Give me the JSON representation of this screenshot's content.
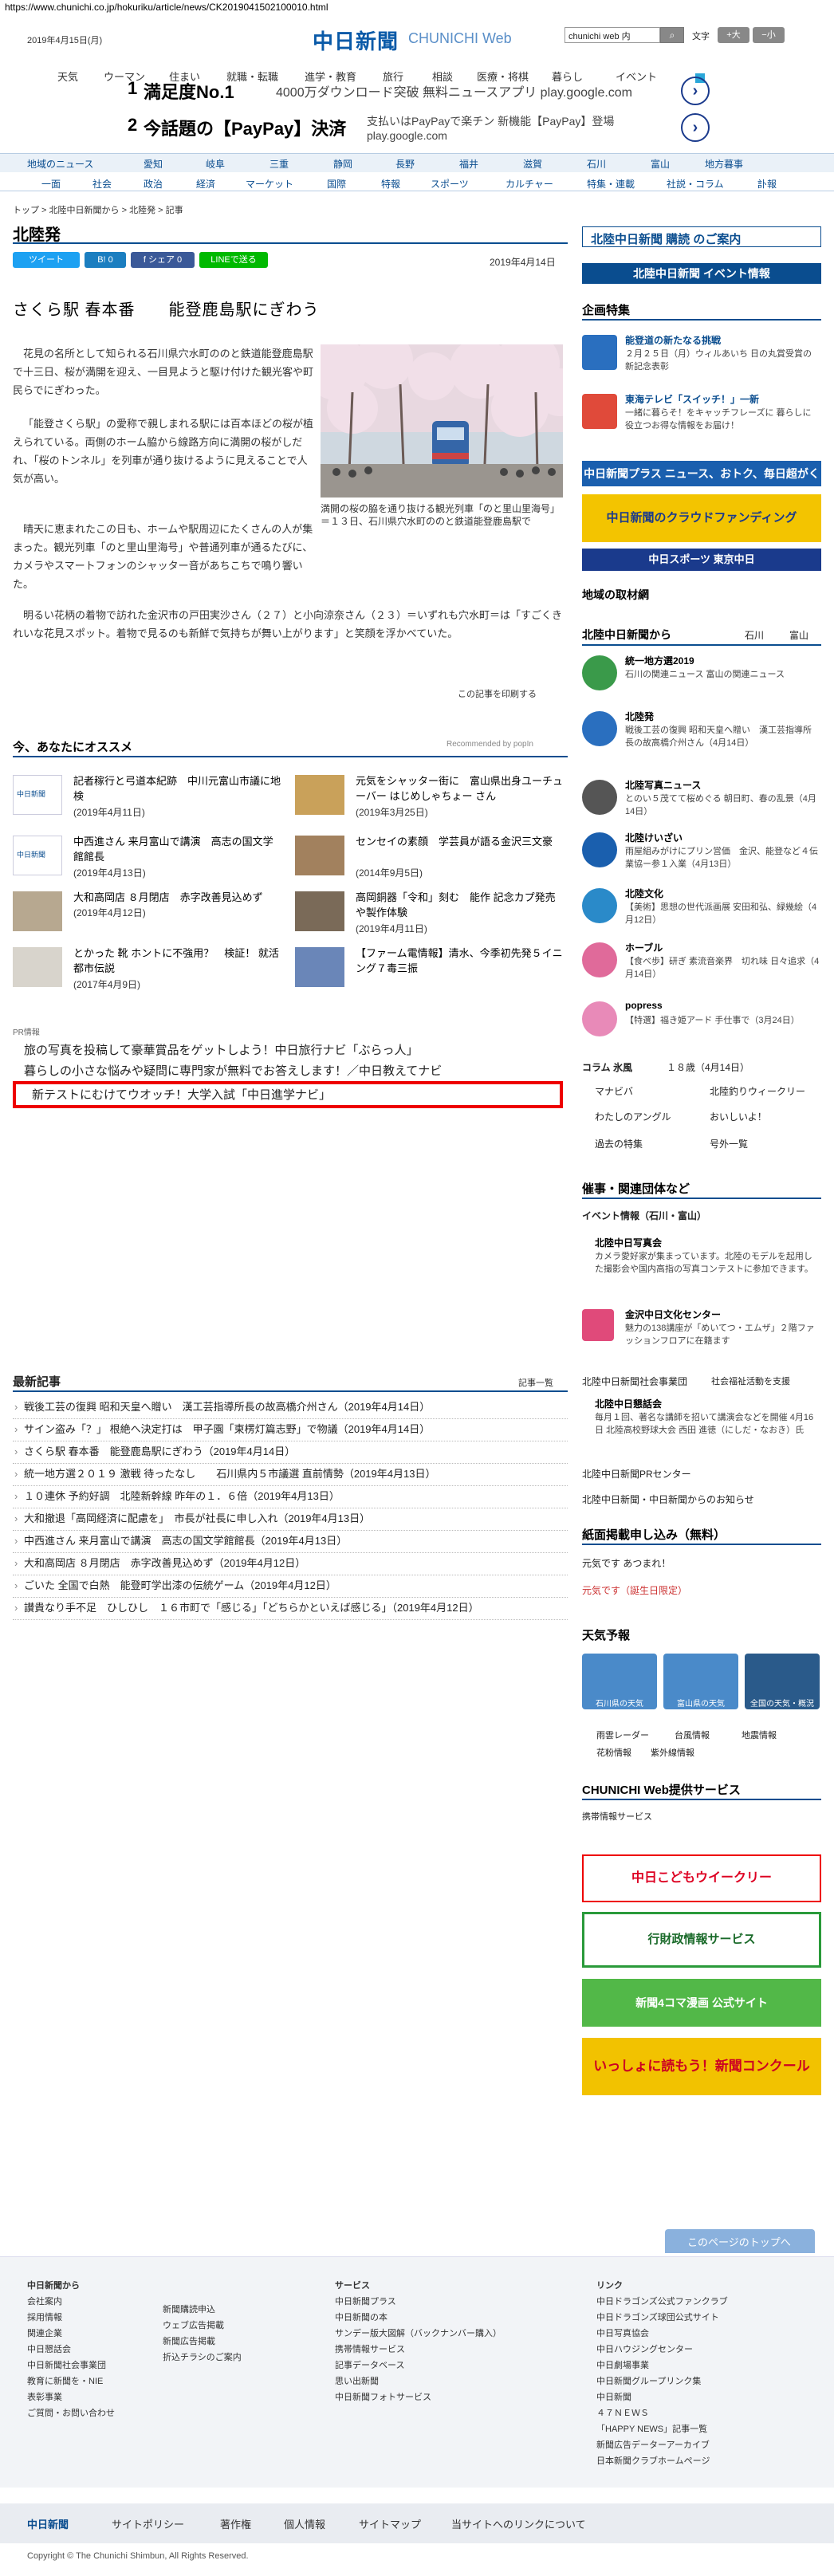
{
  "url": "https://www.chunichi.co.jp/hokuriku/article/news/CK2019041502100010.html",
  "header": {
    "date": "2019年4月15日(月)",
    "logo": "中日新聞",
    "logo_sub": "CHUNICHI Web",
    "search_value": "chunichi web 内",
    "text_size_label": "文字",
    "size_large": "+大",
    "size_small": "−小"
  },
  "top_nav": [
    "天気",
    "ウーマン",
    "住まい",
    "就職・転職",
    "進学・教育",
    "旅行",
    "相談",
    "医療・将棋",
    "暮らし",
    "イベント"
  ],
  "ads": [
    {
      "num": "1",
      "title": "満足度No.1",
      "desc": "4000万ダウンロード突破 無料ニュースアプリ play.google.com"
    },
    {
      "num": "2",
      "title": "今話題の【PayPay】決済",
      "desc": "支払いはPayPayで楽チン 新機能【PayPay】登場",
      "desc2": "play.google.com"
    }
  ],
  "region_nav": [
    "地域のニュース",
    "愛知",
    "岐阜",
    "三重",
    "静岡",
    "長野",
    "福井",
    "滋賀",
    "石川",
    "富山",
    "地方暮事"
  ],
  "cat_nav": [
    "一面",
    "社会",
    "政治",
    "経済",
    "マーケット",
    "国際",
    "特報",
    "スポーツ",
    "カルチャー",
    "特集・連載",
    "社説・コラム",
    "訃報"
  ],
  "breadcrumb": "トップ > 北陸中日新聞から > 北陸発 > 記事",
  "page_title": "北陸発",
  "share": {
    "tweet": "ツイート",
    "hatena": "B! 0",
    "facebook": "f シェア 0",
    "line": "LINEで送る"
  },
  "article": {
    "date": "2019年4月14日",
    "headline": "さくら駅 春本番　　能登鹿島駅にぎわう",
    "p1": "花見の名所として知られる石川県穴水町ののと鉄道能登鹿島駅で十三日、桜が満開を迎え、一目見ようと駆け付けた観光客や町民らでにぎわった。",
    "p2": "「能登さくら駅」の愛称で親しまれる駅には百本ほどの桜が植えられている。両側のホーム脇から線路方向に満開の桜がしだれ、「桜のトンネル」を列車が通り抜けるように見えることで人気が高い。",
    "p3": "晴天に恵まれたこの日も、ホームや駅周辺にたくさんの人が集まった。観光列車「のと里山里海号」や普通列車が通るたびに、カメラやスマートフォンのシャッター音があちこちで鳴り響いた。",
    "p4": "明るい花柄の着物で訪れた金沢市の戸田実沙さん（２７）と小向涼奈さん（２３）＝いずれも穴水町＝は「すごくきれいな花見スポット。着物で見るのも新鮮で気持ちが舞い上がります」と笑顔を浮かべていた。",
    "caption": "満開の桜の脇を通り抜ける観光列車「のと里山里海号」＝１３日、石川県穴水町ののと鉄道能登鹿島駅で",
    "print": "この記事を印刷する"
  },
  "recommend": {
    "head": "今、あなたにオススメ",
    "powered": "Recommended by popIn",
    "items": [
      {
        "title": "記者稼行と弓道本紀跡　中川元富山市議に地検",
        "date": "(2019年4月11日)"
      },
      {
        "title": "元気をシャッター街に　富山県出身ユーチューバー はじめしゃちょー さん",
        "date": "(2019年3月25日)"
      },
      {
        "title": "中西進さん 来月富山で講演　高志の国文学館館長",
        "date": "(2019年4月13日)"
      },
      {
        "title": "センセイの素顔　学芸員が語る金沢三文豪",
        "date": "(2014年9月5日)"
      },
      {
        "title": "大和高岡店 ８月閉店　赤字改善見込めず",
        "date": "(2019年4月12日)"
      },
      {
        "title": "高岡銅器「令和」刻む　能作 記念カプ発売や製作体験",
        "date": "(2019年4月11日)"
      },
      {
        "title": "とかった 靴 ホントに不強用？　検証！ 就活都市伝説",
        "date": "(2017年4月9日)"
      },
      {
        "title": "【ファーム電情報】清水、今季初先発５イニング７毒三振",
        "date": ""
      }
    ]
  },
  "pr": {
    "label": "PR情報",
    "items": [
      "旅の写真を投稿して豪華賞品をゲットしよう！中日旅行ナビ「ぶらっ人」",
      "暮らしの小さな悩みや疑問に専門家が無料でお答えします！／中日教えてナビ",
      "新テストにむけてウオッチ！大学入試「中日進学ナビ」"
    ]
  },
  "latest": {
    "head": "最新記事",
    "more": "記事一覧",
    "items": [
      "戦後工芸の復興 昭和天皇へ贈い　漢工芸指導所長の故高橋介州さん（2019年4月14日）",
      "サイン盗み「？」 根絶へ決定打は　甲子園「柬楞灯篇志野」で物議（2019年4月14日）",
      "さくら駅 春本番　能登鹿島駅にぎわう（2019年4月14日）",
      "統一地方選２０１９ 激戦 待ったなし　　石川県内５市議選 直前情勢（2019年4月13日）",
      "１０連休 予約好調　北陸新幹線 昨年の１．６倍（2019年4月13日）",
      "大和撤退「高岡経済に配慮を」　市長が社長に申し入れ（2019年4月13日）",
      "中西進さん 来月富山で講演　高志の国文学館館長（2019年4月13日）",
      "大和高岡店 ８月閉店　赤字改善見込めず（2019年4月12日）",
      "ごいた 全国で白熱　能登町学出漆の伝統ゲーム（2019年4月12日）",
      "讃貴なり手不足　ひしひし　１６市町で「感じる」「どちらかといえば感じる」（2019年4月12日）"
    ]
  },
  "side": {
    "hokuriku_sub": "北陸中日新聞 購読 のご案内",
    "hokuriku_event": "北陸中日新聞 イベント情報",
    "kikaku": "企画特集",
    "kikaku_items": [
      {
        "title": "能登道の新たなる挑戦",
        "text": "２月２５日（月）ウィルあいち 日の丸賞受賞の新記念表彰"
      },
      {
        "title": "東海テレビ「スイッチ！」一新",
        "text": "一緒に暮らそ！をキャッチフレーズに 暮らしに役立つお得な情報をお届け！"
      }
    ],
    "plus": "中日新聞プラス ニュース、おトク、毎日超がくさん",
    "funding": "中日新聞のクラウドファンディング",
    "tokyo": "中日スポーツ 東京中日",
    "local_head": "地域の取材網",
    "from_head": "北陸中日新聞から",
    "from_links": [
      "石川",
      "富山"
    ],
    "from_items": [
      {
        "title": "統一地方選2019",
        "text": "石川の関連ニュース 富山の関連ニュース"
      },
      {
        "title": "北陸発",
        "text": "戦後工芸の復興 昭和天皇へ贈い　漢工芸指導所長の故高橋介州さん（4月14日）"
      },
      {
        "title": "北陸写真ニュース",
        "text": "とのい５茂てて桜めぐる 朝日町、春の乱景（4月14日）"
      },
      {
        "title": "北陸けいざい",
        "text": "雨屋組みがけにプリン営価　金沢、能登など４伝業協ー参１入業（4月13日）"
      },
      {
        "title": "北陸文化",
        "text": "【美術】思想の世代派画展 安田和弘、緑幾絵（4月12日）"
      },
      {
        "title": "ホーブル",
        "text": "【食べ歩】研ぎ 素流音楽界　切れ味 日々追求（4月14日）"
      },
      {
        "title": "popress",
        "text": "【特選】福き姫アード 手仕事で（3月24日）"
      }
    ],
    "column": "コラム 氷風",
    "column_text": "１８歳（4月14日）",
    "links_a": [
      "マナビバ",
      "わたしのアングル",
      "過去の特集"
    ],
    "links_b": [
      "北陸釣りウィークリー",
      "おいしいよ！",
      "号外一覧"
    ],
    "events_head": "催事・関連団体など",
    "events_link": "イベント情報（石川・富山）",
    "events_items": [
      {
        "title": "北陸中日写真会",
        "text": "カメラ愛好家が集まっています。北陸のモデルを起用した撮影会や国内高指の写真コンテストに参加できます。"
      },
      {
        "title": "金沢中日文化センター",
        "text": "魅力の138講座が「めいてつ・エムザ」２階ファッションフロアに在籍ます"
      },
      {
        "title": "北陸中日新聞社会事業団",
        "text": "社会福祉活動を支援"
      },
      {
        "title": "北陸中日懇話会",
        "text": "毎月１回、著名な講師を招いて講演会などを開催 4月16日 北陸高校野球大会 西田 進徳（にしだ・なおき）氏"
      },
      {
        "title": "北陸中日新聞PRセンター",
        "text": ""
      },
      {
        "title": "北陸中日新聞・中日新聞からのお知らせ",
        "text": ""
      }
    ],
    "shimen_head": "紙面掲載申し込み（無料）",
    "shimen_items": [
      "元気です あつまれ！",
      "元気です（誕生日限定）"
    ],
    "weather_head": "天気予報",
    "weather_tiles": [
      "石川県の天気",
      "富山県の天気",
      "全国の天気・概況"
    ],
    "weather_links": [
      "雨雲レーダー",
      "台風情報",
      "地震情報",
      "花粉情報",
      "紫外線情報"
    ],
    "service_head": "CHUNICHI Web提供サービス",
    "service_link": "携帯情報サービス",
    "kodomo": "中日こどもウイークリー",
    "gyosei": "行財政情報サービス",
    "kanji": "新聞4コマ漫画 公式サイト",
    "concours": "いっしょに読もう！新聞コンクール"
  },
  "footer": {
    "page_top": "このページのトップへ",
    "col1_head": "中日新聞から",
    "col1": [
      "会社案内",
      "採用情報",
      "関連企業",
      "中日懇話会",
      "中日新聞社会事業団",
      "教育に新聞を・NIE",
      "表彰事業",
      "ご質問・お問い合わせ"
    ],
    "col2": [
      "新聞購読申込",
      "ウェブ広告掲載",
      "新聞広告掲載",
      "折込チラシのご案内"
    ],
    "col3_head": "サービス",
    "col3": [
      "中日新聞プラス",
      "中日新聞の本",
      "サンデー版大図解（バックナンバー購入）",
      "携帯情報サービス",
      "記事データベース",
      "思い出新聞",
      "中日新聞フォトサービス"
    ],
    "col4_head": "リンク",
    "col4": [
      "中日ドラゴンズ公式ファンクラブ",
      "中日ドラゴンズ球団公式サイト",
      "中日写真協会",
      "中日ハウジングセンター",
      "中日劇場事業",
      "中日新聞グループリンク集",
      "中日新聞",
      "４７ＮＥＷＳ",
      "「HAPPY NEWS」記事一覧",
      "新聞広告データーアーカイブ",
      "日本新聞クラブホームページ"
    ],
    "bottom": [
      "中日新聞",
      "サイトポリシー",
      "著作権",
      "個人情報",
      "サイトマップ",
      "当サイトへのリンクについて"
    ],
    "copyright": "Copyright © The Chunichi Shimbun, All Rights Reserved."
  }
}
